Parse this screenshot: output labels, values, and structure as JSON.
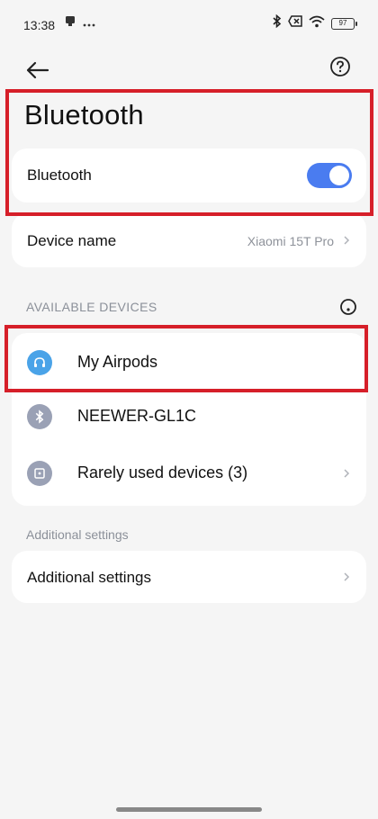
{
  "status_bar": {
    "time": "13:38",
    "left_icons": [
      "notification-icon",
      "more-dots-icon"
    ],
    "right_icons": [
      "bluetooth-icon",
      "no-sim-icon",
      "wifi-icon",
      "battery-icon"
    ],
    "battery_level": "97"
  },
  "header": {
    "back_icon": "arrow-left-icon",
    "help_icon": "help-icon",
    "title": "Bluetooth"
  },
  "bluetooth_toggle": {
    "label": "Bluetooth",
    "enabled": true,
    "color": "#4a7cf0"
  },
  "device_name": {
    "label": "Device name",
    "value": "Xiaomi 15T Pro"
  },
  "available_devices": {
    "section_title": "AVAILABLE DEVICES",
    "scan_icon": "scanning-icon",
    "items": [
      {
        "name": "My Airpods",
        "icon": "headphones-icon",
        "icon_color": "#4aa3e8"
      },
      {
        "name": "NEEWER-GL1C",
        "icon": "bluetooth-icon",
        "icon_color": "#9aa1b5"
      },
      {
        "name": "Rarely used devices (3)",
        "icon": "device-box-icon",
        "icon_color": "#9aa1b5"
      }
    ]
  },
  "additional": {
    "section_title": "Additional settings",
    "row_label": "Additional settings"
  },
  "annotation_color": "#d61f29"
}
